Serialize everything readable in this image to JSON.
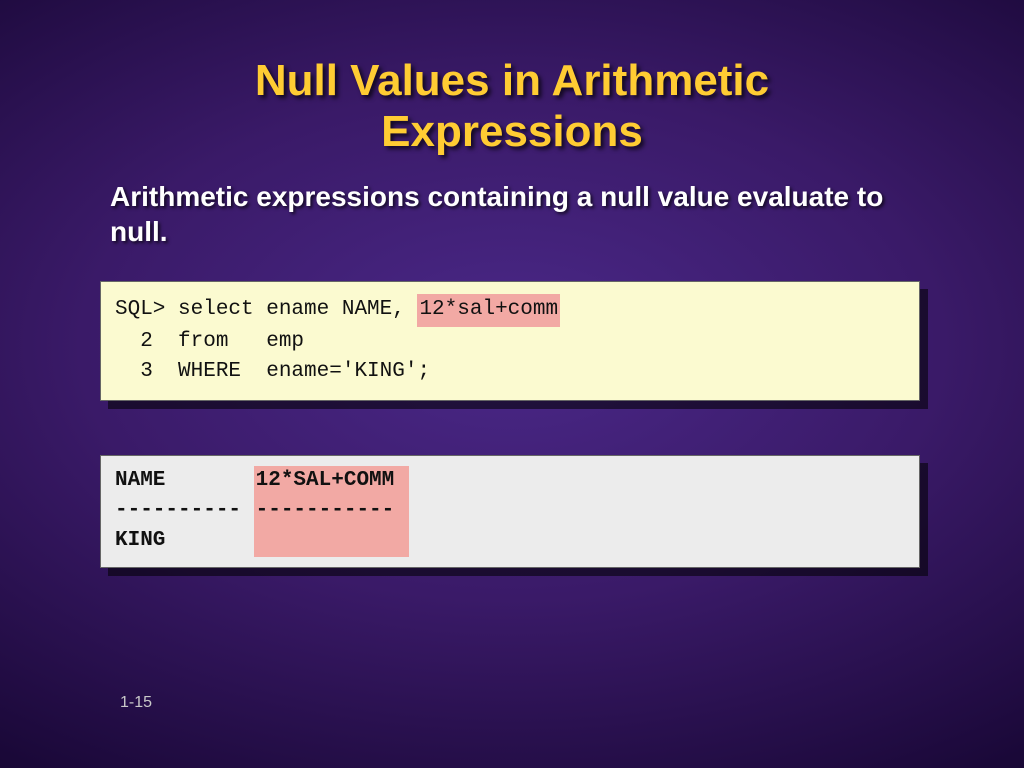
{
  "title_line1": "Null Values in Arithmetic",
  "title_line2": "Expressions",
  "subtitle": "Arithmetic expressions containing a null value evaluate to null.",
  "code": {
    "pre1": "SQL> select ename NAME, ",
    "hl": "12*sal+comm",
    "post1": "",
    "line2": "  2  from   emp",
    "line3": "  3  WHERE  ename='KING';"
  },
  "output": {
    "col1": "NAME       ",
    "hl_col": "12*SAL+COMM ",
    "divider": "---------- ",
    "hl_div": "----------- ",
    "val1": "KING       ",
    "hl_val": "            "
  },
  "page_number": "1-15"
}
